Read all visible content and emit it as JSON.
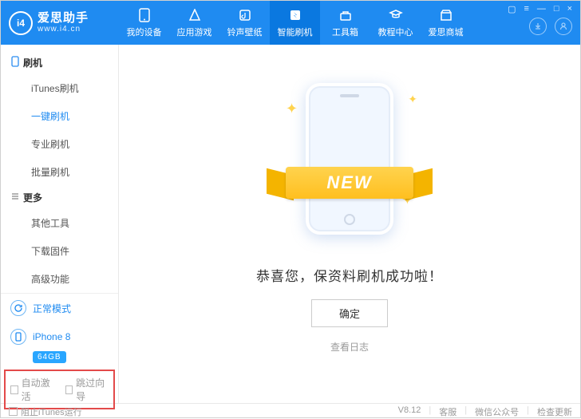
{
  "brand": {
    "title": "爱思助手",
    "sub": "www.i4.cn",
    "logo": "i4"
  },
  "window_controls": [
    "▢",
    "≡",
    "—",
    "□",
    "×"
  ],
  "tabs": [
    {
      "label": "我的设备",
      "icon": "device"
    },
    {
      "label": "应用游戏",
      "icon": "apps"
    },
    {
      "label": "铃声壁纸",
      "icon": "ringtone"
    },
    {
      "label": "智能刷机",
      "icon": "flash",
      "active": true
    },
    {
      "label": "工具箱",
      "icon": "toolbox"
    },
    {
      "label": "教程中心",
      "icon": "tutorial"
    },
    {
      "label": "爱思商城",
      "icon": "store"
    }
  ],
  "sidebar": {
    "groups": [
      {
        "title": "刷机",
        "icon": "phone",
        "items": [
          {
            "label": "iTunes刷机"
          },
          {
            "label": "一键刷机",
            "active": true
          },
          {
            "label": "专业刷机"
          },
          {
            "label": "批量刷机"
          }
        ]
      },
      {
        "title": "更多",
        "icon": "more",
        "items": [
          {
            "label": "其他工具"
          },
          {
            "label": "下载固件"
          },
          {
            "label": "高级功能"
          }
        ]
      }
    ],
    "mode_label": "正常模式",
    "device": {
      "name": "iPhone 8",
      "storage": "64GB"
    },
    "auto_activate": "自动激活",
    "skip_wizard": "跳过向导"
  },
  "content": {
    "ribbon": "NEW",
    "success": "恭喜您，保资料刷机成功啦！",
    "confirm": "确定",
    "view_log": "查看日志"
  },
  "footer": {
    "block_itunes": "阻止iTunes运行",
    "version": "V8.12",
    "links": [
      "客服",
      "微信公众号",
      "检查更新"
    ]
  }
}
